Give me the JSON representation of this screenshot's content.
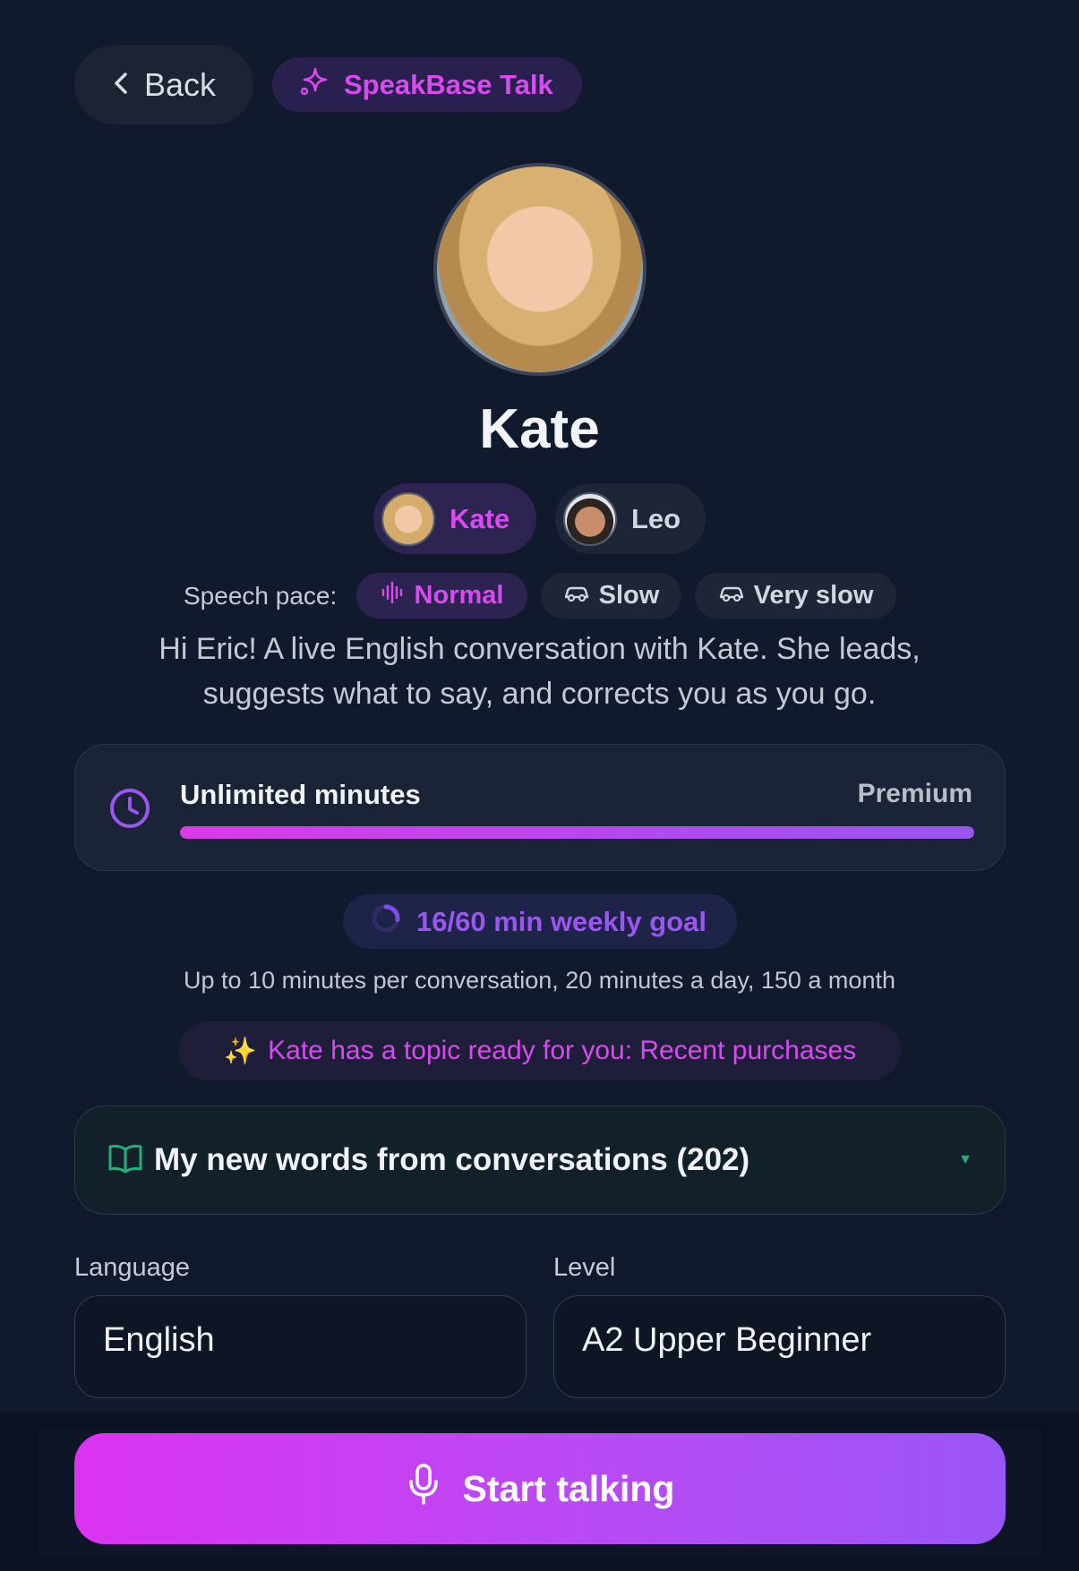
{
  "header": {
    "back_label": "Back",
    "brand_label": "SpeakBase Talk"
  },
  "tutor": {
    "name": "Kate"
  },
  "voices": [
    {
      "label": "Kate",
      "selected": true
    },
    {
      "label": "Leo",
      "selected": false
    }
  ],
  "speech_pace": {
    "label": "Speech pace:",
    "options": [
      {
        "label": "Normal",
        "selected": true
      },
      {
        "label": "Slow",
        "selected": false
      },
      {
        "label": "Very slow",
        "selected": false
      }
    ]
  },
  "intro_text": "Hi Eric! A live English conversation with Kate. She leads, suggests what to say, and corrects you as you go.",
  "minutes_card": {
    "title": "Unlimited minutes",
    "plan": "Premium",
    "progress_percent": 100
  },
  "weekly_goal": {
    "label": "16/60 min weekly goal",
    "done": 16,
    "target": 60
  },
  "limits_text": "Up to 10 minutes per conversation, 20 minutes a day, 150 a month",
  "topic": {
    "emoji": "✨",
    "text": "Kate has a topic ready for you: Recent purchases"
  },
  "words": {
    "label": "My new words from conversations (202)"
  },
  "language": {
    "label": "Language",
    "value": "English"
  },
  "level": {
    "label": "Level",
    "value": "A2 Upper Beginner"
  },
  "cta": {
    "label": "Start talking"
  },
  "colors": {
    "background": "#111a2d",
    "accent_magenta": "#d94af0",
    "accent_purple": "#9a56f0",
    "green_icon": "#22b07a"
  },
  "icons": [
    "chevron-left-icon",
    "sparkles-icon",
    "waveform-icon",
    "car-icon",
    "clock-icon",
    "progress-ring-icon",
    "open-book-icon",
    "caret-down-icon",
    "microphone-icon"
  ]
}
